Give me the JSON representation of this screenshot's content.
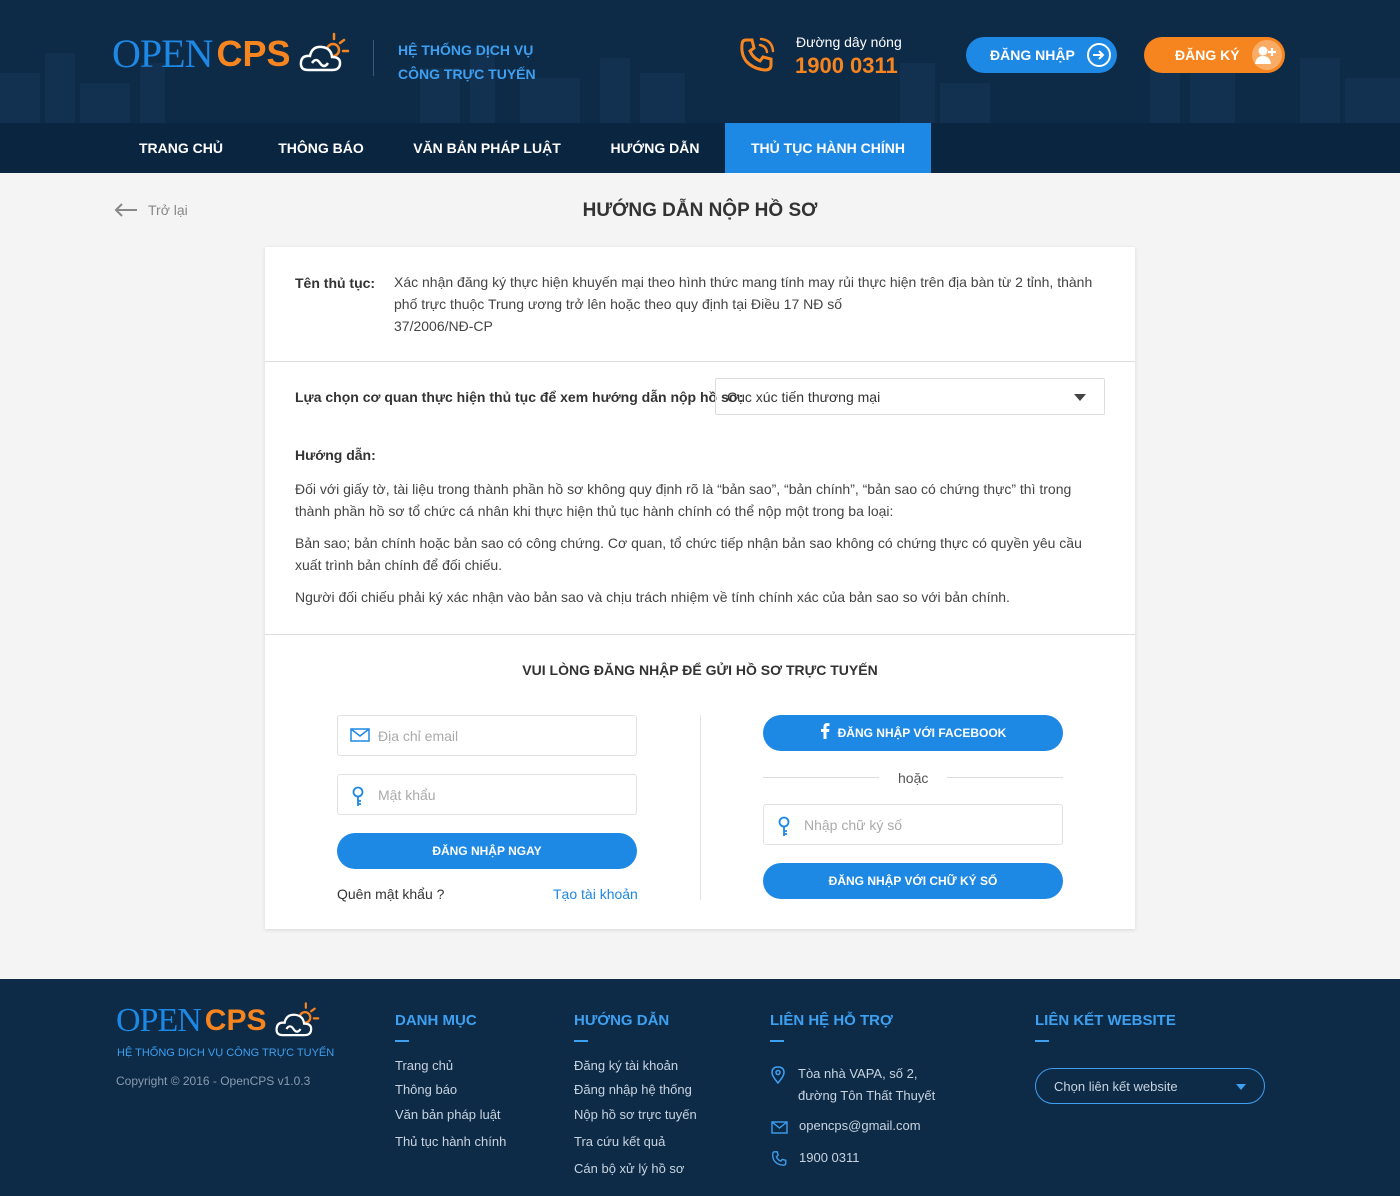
{
  "header": {
    "logo_open": "OPEN",
    "logo_cps": "CPS",
    "tagline_line1": "HỆ THỐNG DỊCH VỤ",
    "tagline_line2": "CÔNG TRỰC TUYẾN",
    "hotline_label": "Đường dây nóng",
    "hotline_number": "1900 0311",
    "login_label": "ĐĂNG NHẬP",
    "register_label": "ĐĂNG KÝ",
    "icons": [
      "phone-icon",
      "sign-in-icon",
      "add-user-icon"
    ]
  },
  "nav": {
    "items": [
      {
        "label": "TRANG CHỦ"
      },
      {
        "label": "THÔNG BÁO"
      },
      {
        "label": "VĂN BẢN PHÁP LUẬT"
      },
      {
        "label": "HƯỚNG DẪN"
      },
      {
        "label": "THỦ TỤC HÀNH CHÍNH",
        "active": true
      }
    ]
  },
  "page": {
    "back_label": "Trở lại",
    "title": "HƯỚNG DẪN NỘP HỒ SƠ"
  },
  "procedure": {
    "label": "Tên thủ tục:",
    "line1": "Xác nhận đăng ký thực hiện khuyến mại theo hình thức mang tính may rủi thực hiện trên địa bàn từ 2 tỉnh, thành",
    "line2": "phố trực thuộc Trung ương trở lên hoặc theo quy định tại Điều 17 NĐ số",
    "line3": "37/2006/NĐ-CP"
  },
  "agency": {
    "label": "Lựa chọn cơ quan thực hiện thủ tục để xem hướng dẫn nộp hồ sơ:",
    "selected": "Cục xúc tiến thương mại"
  },
  "guide": {
    "title": "Hướng dẫn:",
    "p1_line1": "Đối với giấy tờ, tài liệu trong thành phần hồ sơ không quy định rõ là “bản sao”, “bản chính”, “bản sao có chứng thực” thì trong",
    "p1_line2": "thành phần hồ sơ tổ chức cá nhân khi thực hiện thủ tục hành chính có thể nộp một trong ba loại:",
    "p2_line1": "Bản sao; bản chính hoặc bản sao có công chứng. Cơ quan, tổ chức tiếp nhận bản sao không có chứng thực có quyền yêu cầu",
    "p2_line2": "xuất trình bản chính để đối chiếu.",
    "p3": "Người đối chiếu phải ký xác nhận vào bản sao và chịu trách nhiệm về tính chính xác của bản sao so với bản chính."
  },
  "login": {
    "title": "VUI LÒNG ĐĂNG NHẬP ĐỂ GỬI HỒ SƠ TRỰC TUYẾN",
    "email_placeholder": "Địa chỉ email",
    "password_placeholder": "Mật khẩu",
    "login_now": "ĐĂNG NHẬP NGAY",
    "forgot": "Quên mật khẩu ?",
    "create_account": "Tạo tài khoản",
    "facebook": "ĐĂNG NHẬP VỚI FACEBOOK",
    "or": "hoặc",
    "signature_placeholder": "Nhập chữ ký số",
    "signature_login": "ĐĂNG NHẬP VỚI CHỮ KÝ SỐ"
  },
  "footer": {
    "logo_open": "OPEN",
    "logo_cps": "CPS",
    "subtitle": "HỆ THỐNG DỊCH VỤ CÔNG TRỰC TUYẾN",
    "copyright": "Copyright © 2016 - OpenCPS v1.0.3",
    "danh_muc": {
      "title": "DANH MỤC",
      "links": [
        "Trang chủ",
        "Thông báo",
        "Văn bản pháp luật",
        "Thủ tục hành chính"
      ]
    },
    "huong_dan": {
      "title": "HƯỚNG DẪN",
      "links": [
        "Đăng ký tài khoản",
        "Đăng nhập hệ thống",
        "Nộp hồ sơ trực tuyến",
        "Tra cứu kết quả",
        "Cán bộ xử lý hồ sơ"
      ]
    },
    "lien_he": {
      "title": "LIÊN HỆ HỖ TRỢ",
      "address_line1": "Tòa nhà VAPA, số 2,",
      "address_line2": "đường Tôn Thất Thuyết",
      "email": "opencps@gmail.com",
      "phone": "1900 0311"
    },
    "lien_ket": {
      "title": "LIÊN KẾT WEBSITE",
      "select": "Chọn liên kết website"
    }
  },
  "colors": {
    "header_bg": "#0d2a47",
    "accent_blue": "#1e88e5",
    "accent_orange": "#f7851f"
  }
}
